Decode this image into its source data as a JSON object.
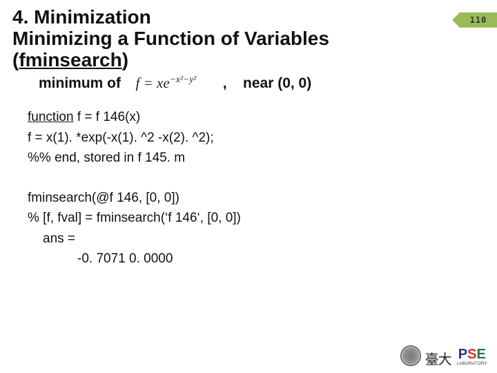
{
  "page_number": "110",
  "title_line1": "4. Minimization",
  "title_line2_a": "Minimizing a Function of Variables",
  "title_line3_open": "(",
  "title_line3_name": "fminsearch",
  "title_line3_close": ")",
  "subhead_prefix": "minimum of",
  "subhead_comma": ",",
  "subhead_near": "near (0, 0)",
  "formula_f": "f",
  "formula_eq": " = ",
  "formula_xe": "xe",
  "formula_exp": "−x²−y²",
  "code1": {
    "l1_kw": "function",
    "l1_rest": " f = f 146(x)",
    "l2": "f  = x(1). *exp(-x(1). ^2 -x(2). ^2);",
    "l3": "%% end, stored in f 145. m"
  },
  "code2": {
    "l1a": "fminsearch(",
    "l1b": "@f 146",
    "l1c": ", [0, 0])",
    "l2": "% [f, fval] = fminsearch(‘f 146‘, [0, 0])",
    "l3": "ans =",
    "l4": "-0. 7071   0. 0000"
  },
  "footer": {
    "school": "臺大",
    "pse_p": "P",
    "pse_s": "S",
    "pse_e": "E",
    "pse_lab": "LABORATORY"
  }
}
